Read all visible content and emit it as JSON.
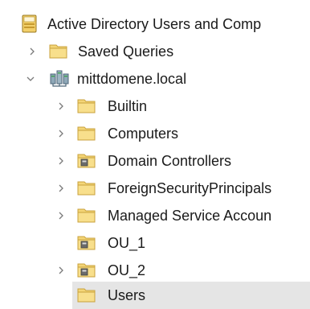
{
  "tree": {
    "root": {
      "label": "Active Directory Users and Comp",
      "icon": "ad-console-icon"
    },
    "saved_queries": {
      "label": "Saved Queries",
      "icon": "folder-icon",
      "expanded": false
    },
    "domain": {
      "label": "mittdomene.local",
      "icon": "domain-icon",
      "expanded": true
    },
    "children": [
      {
        "label": "Builtin",
        "icon": "folder-icon",
        "has_chevron": true
      },
      {
        "label": "Computers",
        "icon": "folder-icon",
        "has_chevron": true
      },
      {
        "label": "Domain Controllers",
        "icon": "ou-icon",
        "has_chevron": true
      },
      {
        "label": "ForeignSecurityPrincipals",
        "icon": "folder-icon",
        "has_chevron": true
      },
      {
        "label": "Managed Service Accoun",
        "icon": "folder-icon",
        "has_chevron": true
      },
      {
        "label": "OU_1",
        "icon": "ou-icon",
        "has_chevron": false
      },
      {
        "label": "OU_2",
        "icon": "ou-icon",
        "has_chevron": true
      },
      {
        "label": "Users",
        "icon": "folder-icon",
        "has_chevron": false,
        "selected": true
      }
    ]
  },
  "colors": {
    "folder_fill": "#f4d577",
    "folder_stroke": "#c9a23c",
    "selection_bg": "#e5e5e5",
    "chevron": "#7a7a7a",
    "text": "#1a1a1a"
  }
}
